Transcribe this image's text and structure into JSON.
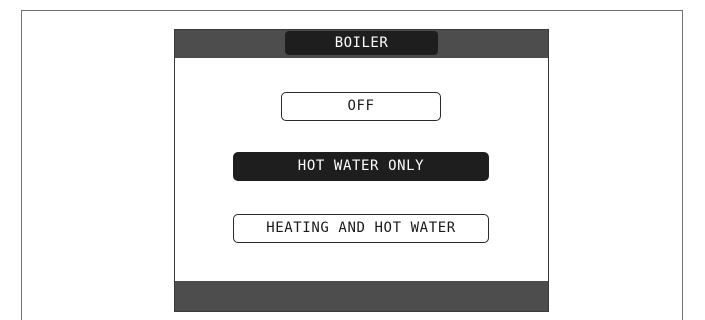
{
  "screen": {
    "title": "BOILER"
  },
  "menu": {
    "options": [
      {
        "label": "OFF",
        "selected": false
      },
      {
        "label": "HOT WATER ONLY",
        "selected": true
      },
      {
        "label": "HEATING AND HOT WATER",
        "selected": false
      }
    ]
  },
  "colors": {
    "bar": "#4d4d4d",
    "selected_background": "#1e1e1e",
    "selected_text": "#ffffff",
    "option_border": "#2a2a2a"
  }
}
